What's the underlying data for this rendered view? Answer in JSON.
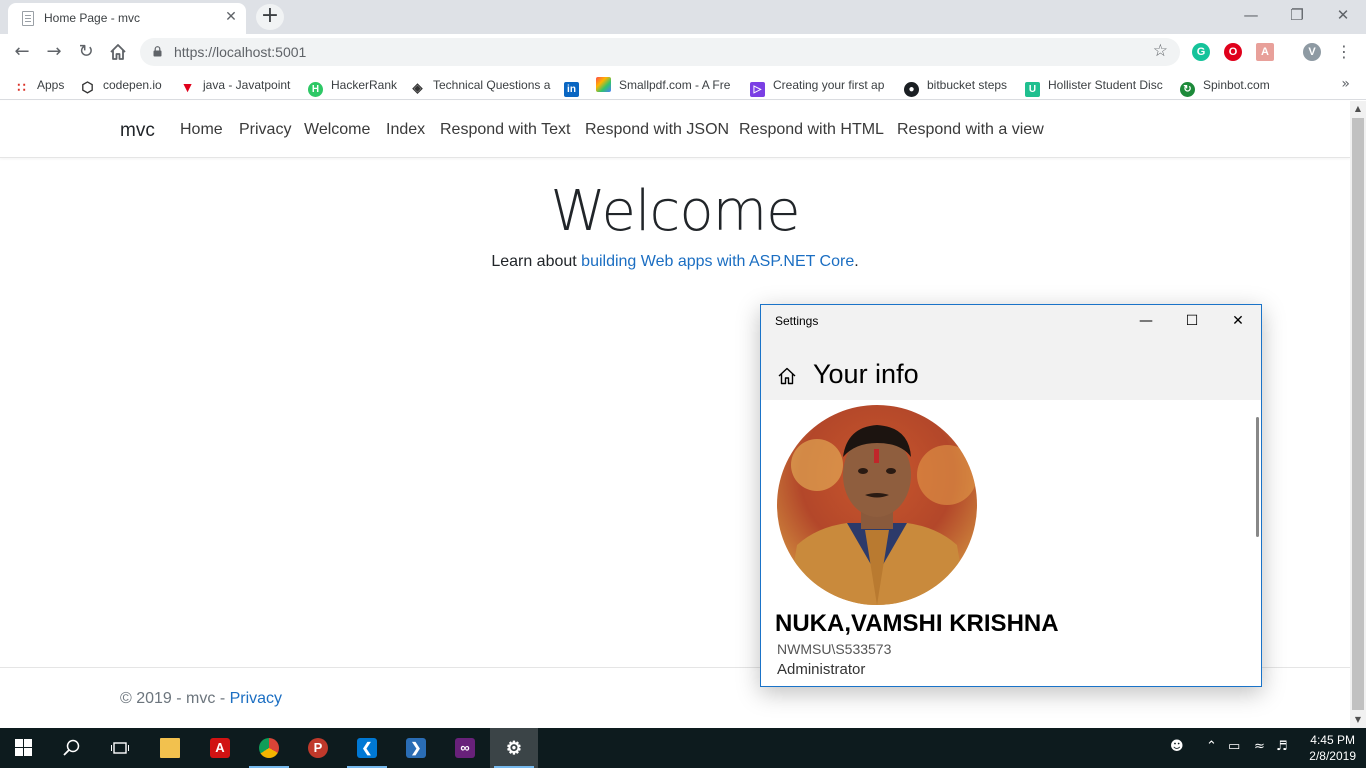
{
  "browser": {
    "tab_title": "Home Page - mvc",
    "tab_close": "✕",
    "new_tab": "+",
    "url": "https://localhost:5001",
    "profile_initial": "V"
  },
  "bookmarks": [
    {
      "label": "Apps",
      "icon": "apps-grid-icon"
    },
    {
      "label": "codepen.io",
      "icon": "codepen-icon"
    },
    {
      "label": "java - Javatpoint",
      "icon": "javatpoint-icon"
    },
    {
      "label": "HackerRank",
      "icon": "hackerrank-icon"
    },
    {
      "label": "Technical Questions a",
      "icon": "technical-questions-icon"
    },
    {
      "label": "",
      "icon": "linkedin-icon"
    },
    {
      "label": "Smallpdf.com - A Fre",
      "icon": "smallpdf-icon"
    },
    {
      "label": "Creating your first ap",
      "icon": "dotnet-icon"
    },
    {
      "label": "bitbucket steps",
      "icon": "github-icon"
    },
    {
      "label": "Hollister Student Disc",
      "icon": "unidays-icon"
    },
    {
      "label": "Spinbot.com",
      "icon": "spinbot-icon"
    }
  ],
  "site": {
    "brand": "mvc",
    "nav": [
      "Home",
      "Privacy",
      "Welcome",
      "Index",
      "Respond with Text",
      "Respond with JSON",
      "Respond with HTML",
      "Respond with a view"
    ],
    "heading": "Welcome",
    "learn_prefix": "Learn about ",
    "learn_link": "building Web apps with ASP.NET Core",
    "learn_suffix": ".",
    "footer_text": "© 2019 - mvc - ",
    "footer_link": "Privacy"
  },
  "settings": {
    "window_title": "Settings",
    "page_title": "Your info",
    "user_name": "NUKA,VAMSHI KRISHNA",
    "account": "NWMSU\\S533573",
    "role": "Administrator"
  },
  "taskbar": {
    "time": "4:45 PM",
    "date": "2/8/2019"
  },
  "colors": {
    "link": "#1b6ec2",
    "taskbar": "#0d1b1e",
    "window_border": "#1a73c8"
  }
}
